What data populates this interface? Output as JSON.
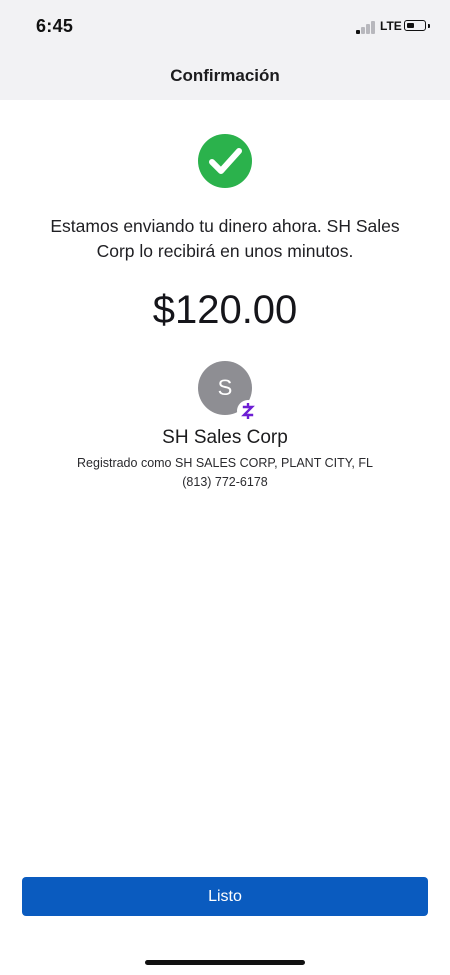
{
  "status_bar": {
    "time": "6:45",
    "network": "LTE",
    "signal_bars_active": 1,
    "signal_bars_total": 4,
    "battery_level": 0.45
  },
  "header": {
    "title": "Confirmación"
  },
  "confirmation": {
    "icon": "check-circle-icon",
    "message": "Estamos enviando tu dinero ahora. SH Sales Corp lo recibirá en unos minutos.",
    "amount": "$120.00"
  },
  "recipient": {
    "initial": "S",
    "badge_icon": "zelle-icon",
    "name": "SH Sales Corp",
    "registration": "Registrado como SH SALES CORP, PLANT CITY, FL",
    "phone": "(813) 772-6178"
  },
  "actions": {
    "done_label": "Listo"
  },
  "colors": {
    "header_bg": "#f2f2f4",
    "success_green": "#2bb24c",
    "primary_button": "#0a5bbf",
    "avatar_gray": "#8e8e93",
    "zelle_purple": "#6d1ed4"
  }
}
